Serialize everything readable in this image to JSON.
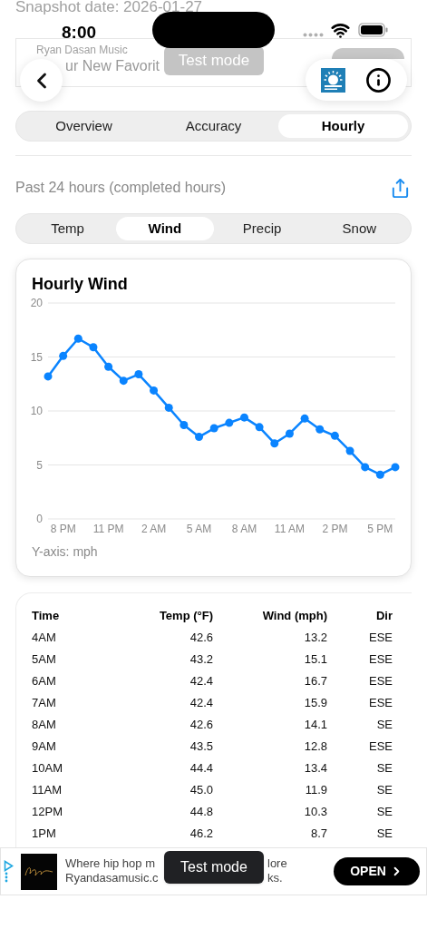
{
  "background": {
    "snapshot_date": "Snapshot date: 2026-01-27",
    "advertiser": "Ryan Dasan Music",
    "headline": "ur New Favorit",
    "toast": "Test mode"
  },
  "status_bar": {
    "time": "8:00"
  },
  "segments": [
    {
      "label": "Overview",
      "selected": false
    },
    {
      "label": "Accuracy",
      "selected": false
    },
    {
      "label": "Hourly",
      "selected": true
    }
  ],
  "subtitle": "Past 24 hours (completed hours)",
  "metric_tabs": [
    {
      "label": "Temp",
      "selected": false
    },
    {
      "label": "Wind",
      "selected": true
    },
    {
      "label": "Precip",
      "selected": false
    },
    {
      "label": "Snow",
      "selected": false
    }
  ],
  "chart": {
    "title": "Hourly Wind",
    "axis_note": "Y-axis: mph",
    "chart_data": {
      "type": "line",
      "categories": [
        null,
        "8 PM",
        null,
        null,
        "11 PM",
        null,
        null,
        "2 AM",
        null,
        null,
        "5 AM",
        null,
        null,
        "8 AM",
        null,
        null,
        "11 AM",
        null,
        null,
        "2 PM",
        null,
        null,
        "5 PM",
        null
      ],
      "series": [
        {
          "color": "#0a84ff",
          "marker": true,
          "values": [
            13.2,
            15.1,
            16.7,
            15.9,
            14.1,
            12.8,
            13.4,
            11.9,
            10.3,
            8.7,
            7.6,
            8.4,
            8.9,
            9.4,
            8.5,
            7.0,
            7.9,
            9.3,
            8.3,
            7.7,
            6.3,
            4.8,
            4.1,
            4.8
          ]
        }
      ],
      "ylim": [
        0,
        20
      ],
      "yticks": [
        0,
        5,
        10,
        15,
        20
      ],
      "grid": true
    }
  },
  "table": {
    "columns": [
      "Time",
      "Temp (°F)",
      "Wind (mph)",
      "Dir"
    ],
    "rows": [
      [
        "4AM",
        "42.6",
        "13.2",
        "ESE"
      ],
      [
        "5AM",
        "43.2",
        "15.1",
        "ESE"
      ],
      [
        "6AM",
        "42.4",
        "16.7",
        "ESE"
      ],
      [
        "7AM",
        "42.4",
        "15.9",
        "ESE"
      ],
      [
        "8AM",
        "42.6",
        "14.1",
        "SE"
      ],
      [
        "9AM",
        "43.5",
        "12.8",
        "ESE"
      ],
      [
        "10AM",
        "44.4",
        "13.4",
        "SE"
      ],
      [
        "11AM",
        "45.0",
        "11.9",
        "SE"
      ],
      [
        "12PM",
        "44.8",
        "10.3",
        "SE"
      ],
      [
        "1PM",
        "46.2",
        "8.7",
        "SE"
      ]
    ]
  },
  "ad": {
    "line_1_start": "Where hip hop m",
    "line_1_end": "lore",
    "line_2_start": "Ryandasamusic.c",
    "line_2_end": "ks.",
    "button": "OPEN"
  },
  "toast": "Test mode"
}
